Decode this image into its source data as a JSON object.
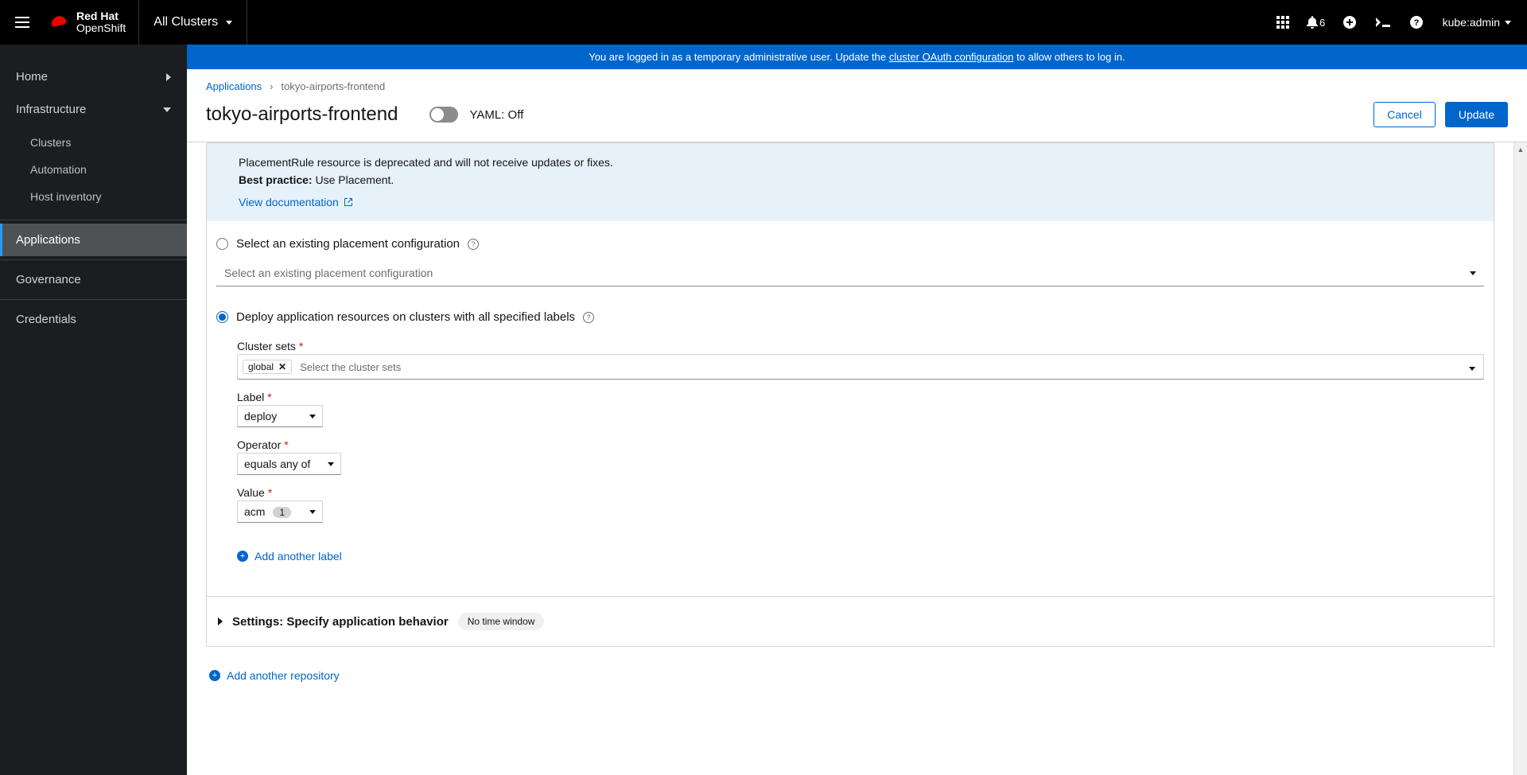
{
  "brand": {
    "line1": "Red Hat",
    "line2": "OpenShift"
  },
  "clusterPicker": "All Clusters",
  "notifications": {
    "count": "6"
  },
  "user": "kube:admin",
  "banner": {
    "prefix": "You are logged in as a temporary administrative user. Update the ",
    "link": "cluster OAuth configuration",
    "suffix": " to allow others to log in."
  },
  "sidebar": {
    "home": "Home",
    "infrastructure": "Infrastructure",
    "clusters": "Clusters",
    "automation": "Automation",
    "hostInventory": "Host inventory",
    "applications": "Applications",
    "governance": "Governance",
    "credentials": "Credentials"
  },
  "breadcrumb": {
    "root": "Applications",
    "current": "tokyo-airports-frontend"
  },
  "page": {
    "title": "tokyo-airports-frontend",
    "yamlLabel": "YAML: Off",
    "cancel": "Cancel",
    "update": "Update"
  },
  "callout": {
    "line1": "PlacementRule resource is deprecated and will not receive updates or fixes.",
    "bestPracticeLabel": "Best practice:",
    "bestPracticeText": " Use Placement.",
    "viewDoc": "View documentation"
  },
  "placement": {
    "existingRadio": "Select an existing placement configuration",
    "existingPlaceholder": "Select an existing placement configuration",
    "deployRadio": "Deploy application resources on clusters with all specified labels",
    "clusterSetsLabel": "Cluster sets",
    "clusterSetChip": "global",
    "clusterSetsPlaceholder": "Select the cluster sets",
    "labelLabel": "Label",
    "labelValue": "deploy",
    "operatorLabel": "Operator",
    "operatorValue": "equals any of",
    "valueLabel": "Value",
    "valueValue": "acm",
    "valueCount": "1",
    "addLabel": "Add another label"
  },
  "settings": {
    "title": "Settings: Specify application behavior",
    "pill": "No time window"
  },
  "addRepo": "Add another repository"
}
